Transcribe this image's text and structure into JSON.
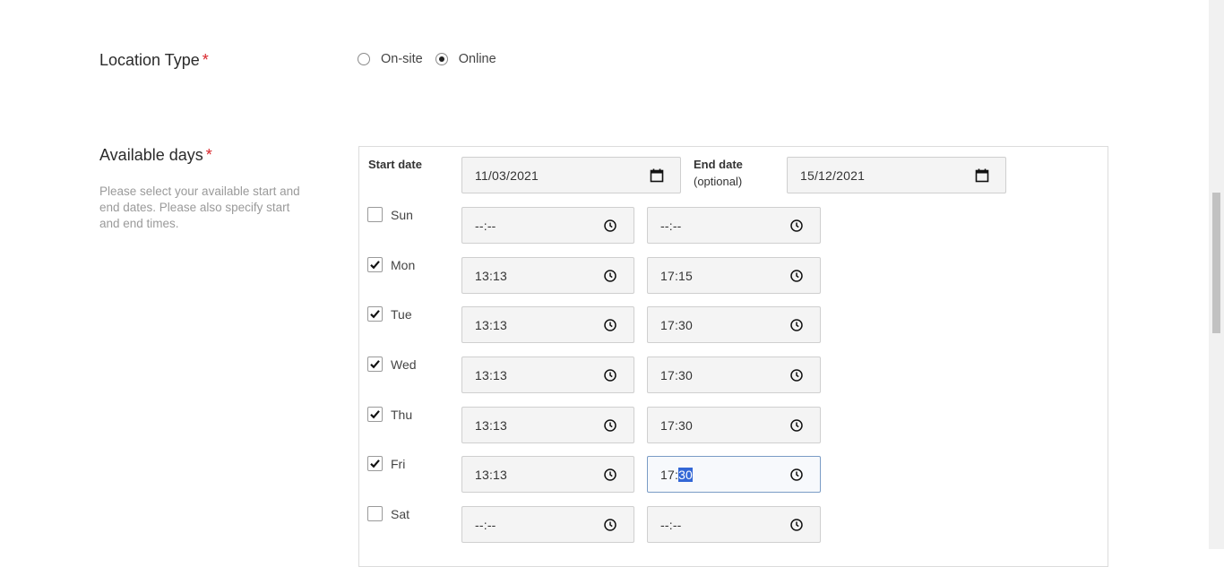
{
  "location": {
    "title": "Location Type",
    "required_mark": "*",
    "options": [
      {
        "label": "On-site",
        "selected": false
      },
      {
        "label": "Online",
        "selected": true
      }
    ]
  },
  "availability": {
    "title": "Available days",
    "required_mark": "*",
    "description": "Please select your available start and end dates. Please also specify start and end times.",
    "start_date_label": "Start date",
    "start_date_value": "11/03/2021",
    "end_date_label_line1": "End date",
    "end_date_label_line2": "(optional)",
    "end_date_value": "15/12/2021",
    "days": [
      {
        "label": "Sun",
        "checked": false,
        "start": "--:--",
        "end": "--:--"
      },
      {
        "label": "Mon",
        "checked": true,
        "start": "13:13",
        "end": "17:15"
      },
      {
        "label": "Tue",
        "checked": true,
        "start": "13:13",
        "end": "17:30"
      },
      {
        "label": "Wed",
        "checked": true,
        "start": "13:13",
        "end": "17:30"
      },
      {
        "label": "Thu",
        "checked": true,
        "start": "13:13",
        "end": "17:30"
      },
      {
        "label": "Fri",
        "checked": true,
        "start": "13:13",
        "end_hours": "17:",
        "end_minutes_selected": "30"
      },
      {
        "label": "Sat",
        "checked": false,
        "start": "--:--",
        "end": "--:--"
      }
    ]
  },
  "colors": {
    "required": "#d9262b",
    "selection": "#3367d6",
    "focus_border": "#7a9cc6"
  }
}
